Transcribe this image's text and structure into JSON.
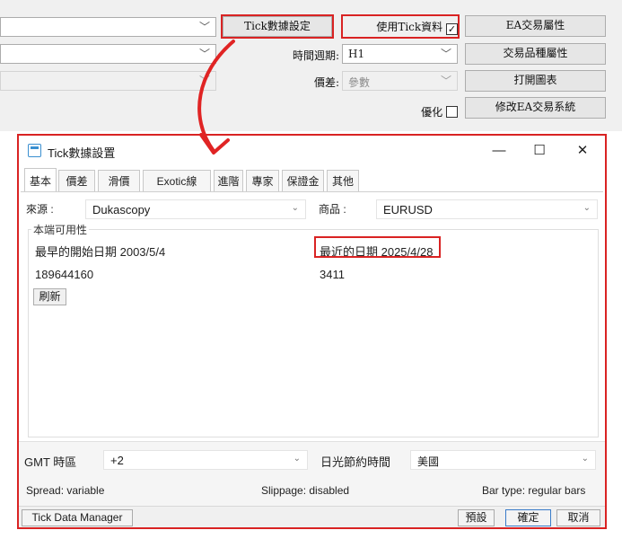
{
  "top": {
    "tick_settings_button": "Tick數據設定",
    "use_tick_label": "使用Tick資料",
    "use_tick_checked": "✓",
    "ea_trade_props_button": "EA交易屬性",
    "period_label": "時間週期:",
    "period_value": "H1",
    "symbol_props_button": "交易品種屬性",
    "spread_label": "價差:",
    "spread_value": "參數",
    "open_chart_button": "打開圖表",
    "optimize_label": "優化",
    "modify_ea_button": "修改EA交易系統"
  },
  "dialog": {
    "title": "Tick數據設置",
    "controls": {
      "minimize": "—",
      "maximize": "☐",
      "close": "✕"
    },
    "tabs": [
      "基本",
      "價差",
      "滑價",
      "Exotic線",
      "進階",
      "專家",
      "保證金",
      "其他"
    ],
    "source_label": "來源 :",
    "source_value": "Dukascopy",
    "symbol_label": "商品 :",
    "symbol_value": "EURUSD",
    "availability_title": "本端可用性",
    "earliest_start": "最早的開始日期 2003/5/4",
    "latest_date": "最近的日期 2025/4/28",
    "count_left": "189644160",
    "count_right": "3411",
    "refresh_button": "刷新",
    "gmt_label": "GMT 時區",
    "gmt_value": "+2",
    "dst_label": "日光節約時間",
    "dst_value": "美國",
    "spread_status": "Spread: variable",
    "slippage_status": "Slippage: disabled",
    "bartype_status": "Bar type: regular bars",
    "manager_label": "Tick Data Manager",
    "preset_button": "預設",
    "ok_button": "確定",
    "cancel_button": "取消"
  },
  "colors": {
    "highlight": "#d92323",
    "icon": "#3a8fd0"
  }
}
